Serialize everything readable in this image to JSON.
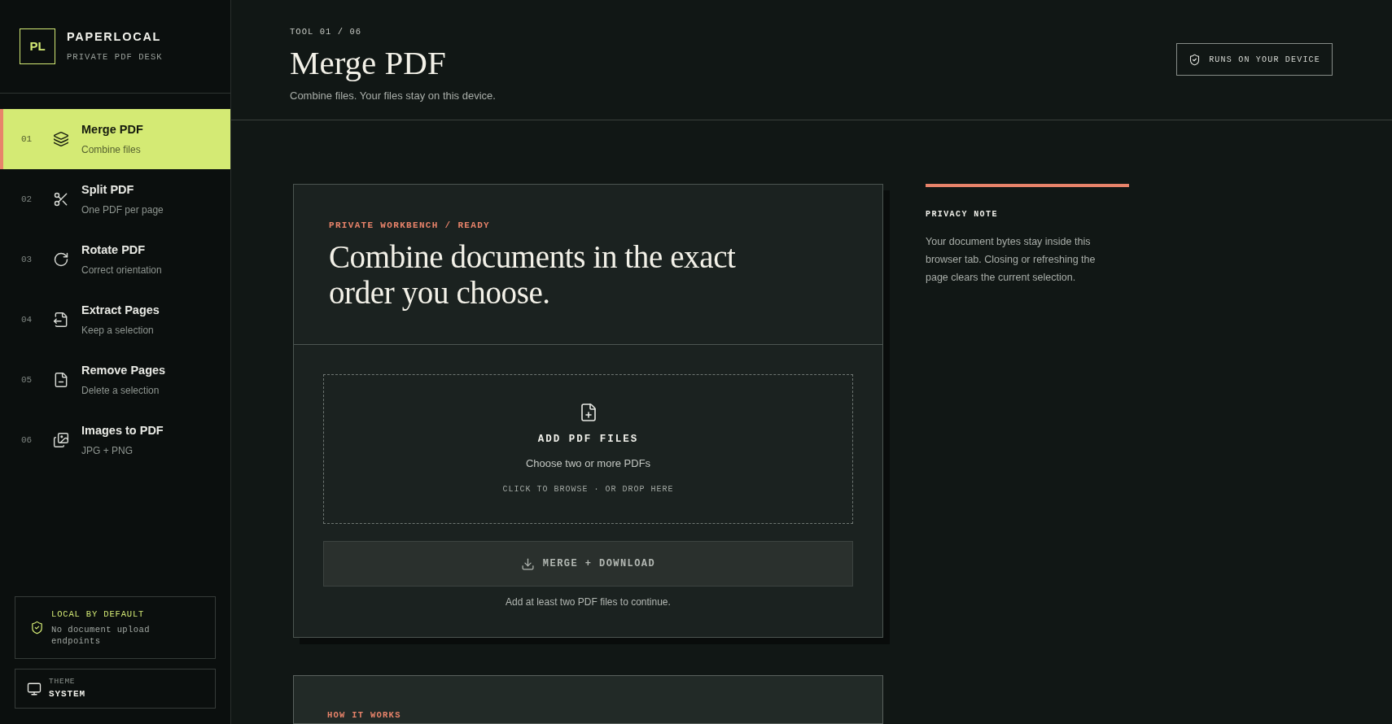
{
  "brand": {
    "logo": "PL",
    "name": "PAPERLOCAL",
    "tagline": "PRIVATE PDF DESK"
  },
  "sidebar": {
    "items": [
      {
        "kind": "merge",
        "number": "01",
        "title": "Merge PDF",
        "subtitle": "Combine files",
        "selected": true
      },
      {
        "kind": "split",
        "number": "02",
        "title": "Split PDF",
        "subtitle": "One PDF per page",
        "selected": false
      },
      {
        "kind": "rotate",
        "number": "03",
        "title": "Rotate PDF",
        "subtitle": "Correct orientation",
        "selected": false
      },
      {
        "kind": "extract",
        "number": "04",
        "title": "Extract Pages",
        "subtitle": "Keep a selection",
        "selected": false
      },
      {
        "kind": "remove",
        "number": "05",
        "title": "Remove Pages",
        "subtitle": "Delete a selection",
        "selected": false
      },
      {
        "kind": "images",
        "number": "06",
        "title": "Images to PDF",
        "subtitle": "JPG + PNG",
        "selected": false
      }
    ],
    "local_card": {
      "title": "LOCAL BY DEFAULT",
      "text": "No document upload endpoints"
    },
    "theme": {
      "label": "THEME",
      "value": "SYSTEM"
    }
  },
  "header": {
    "eyebrow": "TOOL 01 / 06",
    "title": "Merge PDF",
    "subtitle": "Combine files. Your files stay on this device.",
    "badge": "RUNS ON YOUR DEVICE"
  },
  "workbench": {
    "eyebrow": "PRIVATE WORKBENCH / READY",
    "headline": "Combine documents in the exact order you choose.",
    "dropzone": {
      "title": "ADD PDF FILES",
      "text": "Choose two or more PDFs",
      "hint": "CLICK TO BROWSE · OR DROP HERE"
    },
    "button": {
      "label": "MERGE + DOWNLOAD",
      "disabled": true
    },
    "hint": "Add at least two PDF files to continue."
  },
  "privacy_note": {
    "title": "PRIVACY NOTE",
    "text": "Your document bytes stay inside this browser tab. Closing or refreshing the page clears the current selection."
  },
  "how_it_works": {
    "eyebrow": "HOW IT WORKS"
  }
}
